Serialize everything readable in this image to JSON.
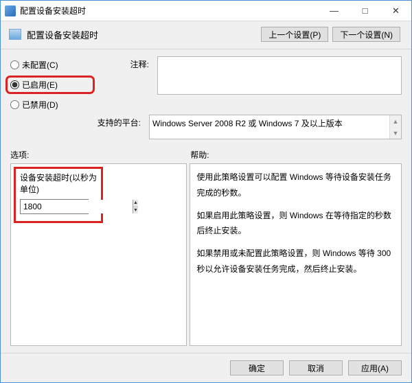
{
  "titlebar": {
    "title": "配置设备安装超时"
  },
  "header": {
    "title": "配置设备安装超时",
    "prev": "上一个设置(P)",
    "next": "下一个设置(N)"
  },
  "radios": {
    "notConfigured": "未配置(C)",
    "enabled": "已启用(E)",
    "disabled": "已禁用(D)"
  },
  "labels": {
    "comment": "注释:",
    "supported": "支持的平台:",
    "options": "选项:",
    "help": "帮助:"
  },
  "supported_text": "Windows Server 2008 R2 或 Windows 7 及以上版本",
  "option": {
    "label": "设备安装超时(以秒为单位)",
    "value": "1800"
  },
  "help": {
    "p1": "使用此策略设置可以配置 Windows 等待设备安装任务完成的秒数。",
    "p2": "如果启用此策略设置，则 Windows 在等待指定的秒数后终止安装。",
    "p3": "如果禁用或未配置此策略设置，则 Windows 等待 300 秒以允许设备安装任务完成，然后终止安装。"
  },
  "footer": {
    "ok": "确定",
    "cancel": "取消",
    "apply": "应用(A)"
  }
}
